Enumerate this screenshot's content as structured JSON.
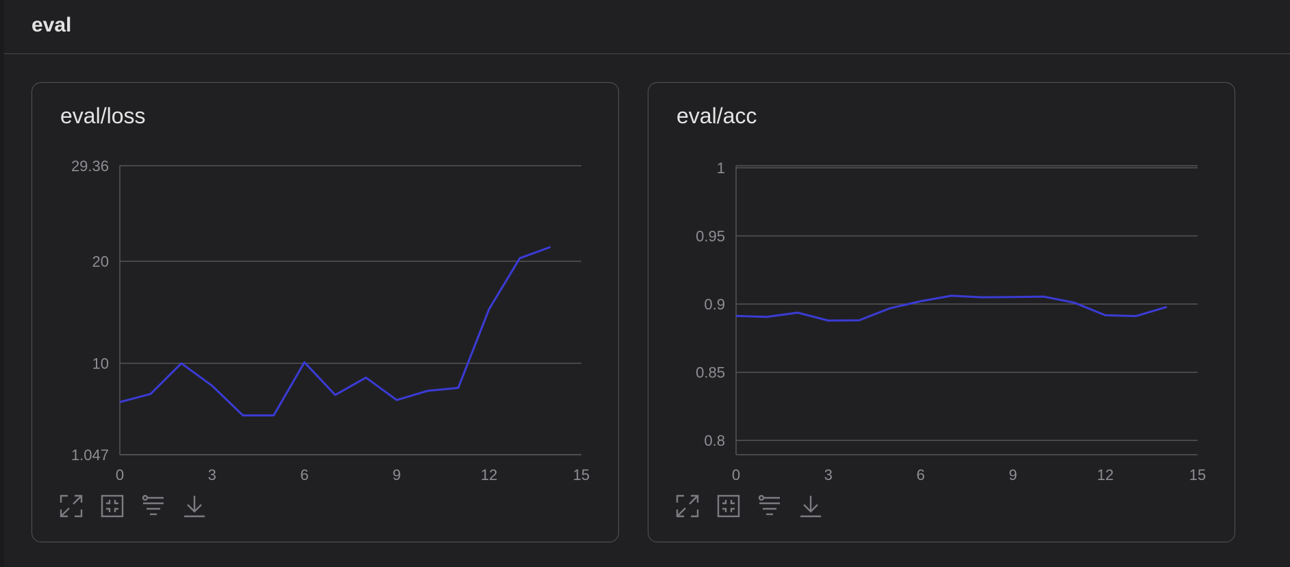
{
  "section": {
    "title": "eval"
  },
  "charts": [
    {
      "title": "eval/loss",
      "tools": {
        "expand": "expand-icon",
        "fit": "fit-icon",
        "filter": "filter-icon",
        "download": "download-icon"
      }
    },
    {
      "title": "eval/acc",
      "tools": {
        "expand": "expand-icon",
        "fit": "fit-icon",
        "filter": "filter-icon",
        "download": "download-icon"
      }
    }
  ],
  "colors": {
    "line": "#3b3bd6",
    "grid": "#55555a",
    "tick": "#8e8e94"
  },
  "chart_data": [
    {
      "type": "line",
      "title": "eval/loss",
      "xlabel": "",
      "ylabel": "",
      "x": [
        0,
        1,
        2,
        3,
        4,
        5,
        6,
        7,
        8,
        9,
        10,
        11,
        12,
        13,
        14
      ],
      "series": [
        {
          "values": [
            6.2,
            7.0,
            10.0,
            7.8,
            4.9,
            4.9,
            10.1,
            6.9,
            8.6,
            6.4,
            7.3,
            7.6,
            15.3,
            20.3,
            21.4
          ]
        }
      ],
      "xlim": [
        0,
        15
      ],
      "xticks": [
        0,
        3,
        6,
        9,
        12,
        15
      ],
      "xtick_labels": [
        "0",
        "3",
        "6",
        "9",
        "12",
        "15"
      ],
      "ylim": [
        1.047,
        29.36
      ],
      "yticks": [
        1.047,
        10,
        20,
        29.36
      ],
      "ytick_labels": [
        "1.047",
        "10",
        "20",
        "29.36"
      ],
      "grid": true,
      "legend": "none"
    },
    {
      "type": "line",
      "title": "eval/acc",
      "xlabel": "",
      "ylabel": "",
      "x": [
        0,
        1,
        2,
        3,
        4,
        5,
        6,
        7,
        8,
        9,
        10,
        11,
        12,
        13,
        14
      ],
      "series": [
        {
          "values": [
            0.8913,
            0.8906,
            0.8937,
            0.8879,
            0.8881,
            0.8969,
            0.9021,
            0.9061,
            0.905,
            0.9052,
            0.9055,
            0.901,
            0.8918,
            0.8912,
            0.8979
          ]
        }
      ],
      "xlim": [
        0,
        15
      ],
      "xticks": [
        0,
        3,
        6,
        9,
        12,
        15
      ],
      "xtick_labels": [
        "0",
        "3",
        "6",
        "9",
        "12",
        "15"
      ],
      "ylim": [
        0.7895,
        1.0015
      ],
      "yticks": [
        0.8,
        0.85,
        0.9,
        0.95,
        1
      ],
      "ytick_labels": [
        "0.8",
        "0.85",
        "0.9",
        "0.95",
        "1"
      ],
      "grid": true,
      "legend": "none"
    }
  ]
}
